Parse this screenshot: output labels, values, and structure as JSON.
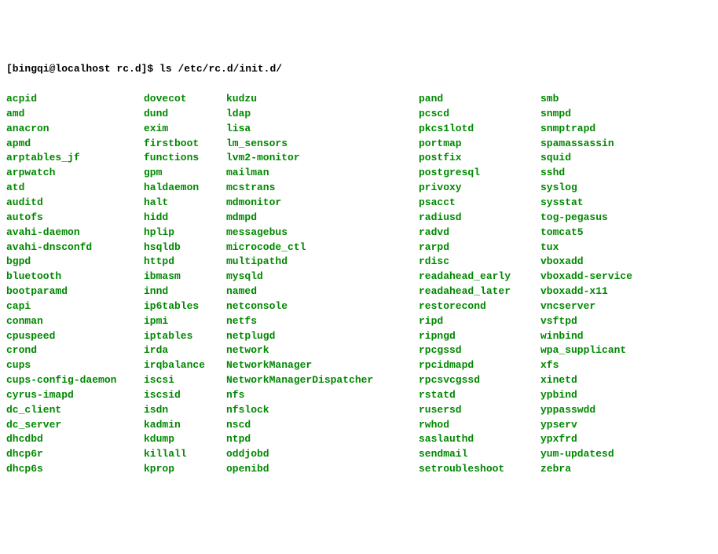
{
  "prompt": {
    "user_host_path": "[bingqi@localhost rc.d]$",
    "command": "ls /etc/rc.d/init.d/"
  },
  "columns": [
    [
      "acpid",
      "amd",
      "anacron",
      "apmd",
      "arptables_jf",
      "arpwatch",
      "atd",
      "auditd",
      "autofs",
      "avahi-daemon",
      "avahi-dnsconfd",
      "bgpd",
      "bluetooth",
      "bootparamd",
      "capi",
      "conman",
      "cpuspeed",
      "crond",
      "cups",
      "cups-config-daemon",
      "cyrus-imapd",
      "dc_client",
      "dc_server",
      "dhcdbd",
      "dhcp6r",
      "dhcp6s"
    ],
    [
      "dovecot",
      "dund",
      "exim",
      "firstboot",
      "functions",
      "gpm",
      "haldaemon",
      "halt",
      "hidd",
      "hplip",
      "hsqldb",
      "httpd",
      "ibmasm",
      "innd",
      "ip6tables",
      "ipmi",
      "iptables",
      "irda",
      "irqbalance",
      "iscsi",
      "iscsid",
      "isdn",
      "kadmin",
      "kdump",
      "killall",
      "kprop"
    ],
    [
      "kudzu",
      "ldap",
      "lisa",
      "lm_sensors",
      "lvm2-monitor",
      "mailman",
      "mcstrans",
      "mdmonitor",
      "mdmpd",
      "messagebus",
      "microcode_ctl",
      "multipathd",
      "mysqld",
      "named",
      "netconsole",
      "netfs",
      "netplugd",
      "network",
      "NetworkManager",
      "NetworkManagerDispatcher",
      "nfs",
      "nfslock",
      "nscd",
      "ntpd",
      "oddjobd",
      "openibd"
    ],
    [
      "pand",
      "pcscd",
      "pkcs1lotd",
      "portmap",
      "postfix",
      "postgresql",
      "privoxy",
      "psacct",
      "radiusd",
      "radvd",
      "rarpd",
      "rdisc",
      "readahead_early",
      "readahead_later",
      "restorecond",
      "ripd",
      "ripngd",
      "rpcgssd",
      "rpcidmapd",
      "rpcsvcgssd",
      "rstatd",
      "rusersd",
      "rwhod",
      "saslauthd",
      "sendmail",
      "setroubleshoot"
    ],
    [
      "smb",
      "snmpd",
      "snmptrapd",
      "spamassassin",
      "squid",
      "sshd",
      "syslog",
      "sysstat",
      "tog-pegasus",
      "tomcat5",
      "tux",
      "vboxadd",
      "vboxadd-service",
      "vboxadd-x11",
      "vncserver",
      "vsftpd",
      "winbind",
      "wpa_supplicant",
      "xfs",
      "xinetd",
      "ypbind",
      "yppasswdd",
      "ypserv",
      "ypxfrd",
      "yum-updatesd",
      "zebra"
    ]
  ]
}
